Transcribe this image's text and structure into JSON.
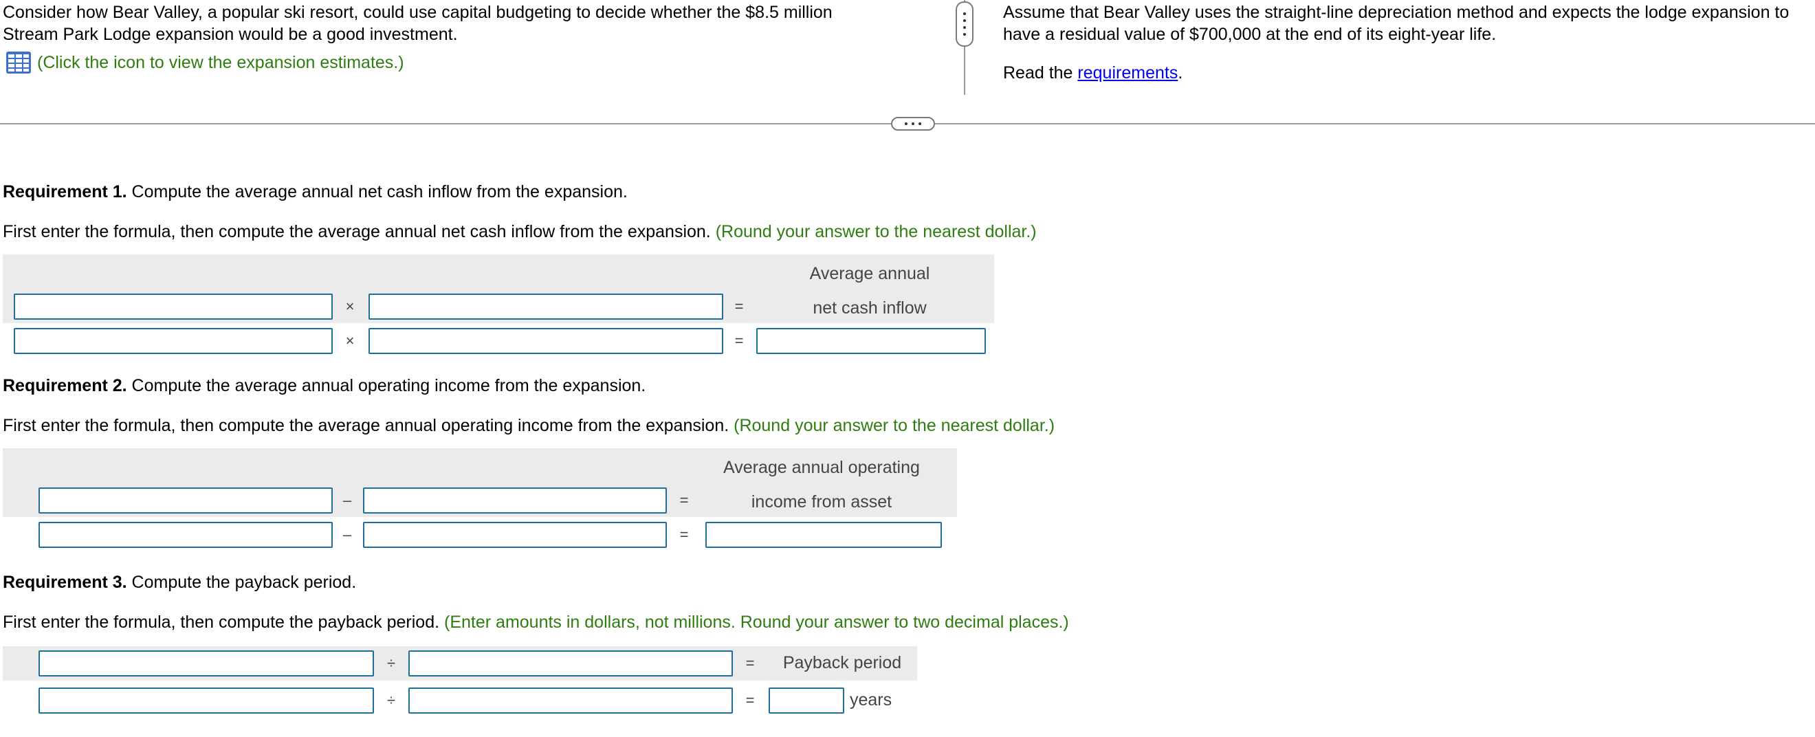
{
  "intro": {
    "line1": "Consider how Bear Valley, a popular ski resort, could use capital budgeting to decide whether the $8.5 million",
    "line2": "Stream Park Lodge expansion would be a good investment.",
    "estimates_link": "(Click the icon to view the expansion estimates.)"
  },
  "right": {
    "line1": "Assume that Bear Valley uses the straight-line depreciation method and expects the lodge expansion to",
    "line2": "have a residual value of $700,000 at the end of its eight-year life.",
    "read_prefix": "Read the ",
    "requirements_link": "requirements",
    "read_suffix": "."
  },
  "req1": {
    "head": "Requirement 1.",
    "title": " Compute the average annual net cash inflow from the expansion.",
    "instruction": "First enter the formula, then compute the average annual net cash inflow from the expansion. ",
    "hint": "(Round your answer to the nearest dollar.)",
    "op": "×",
    "eq": "=",
    "result_label_1": "Average annual",
    "result_label_2": "net cash inflow"
  },
  "req2": {
    "head": "Requirement 2.",
    "title": " Compute the average annual operating income from the expansion.",
    "instruction": "First enter the formula, then compute the average annual operating income from the expansion. ",
    "hint": "(Round your answer to the nearest dollar.)",
    "op": "–",
    "eq": "=",
    "result_label_1": "Average annual operating",
    "result_label_2": "income from asset"
  },
  "req3": {
    "head": "Requirement 3.",
    "title": " Compute the payback period.",
    "instruction": "First enter the formula, then compute the payback period. ",
    "hint": "(Enter amounts in dollars, not millions. Round your answer to two decimal places.)",
    "op": "÷",
    "eq": "=",
    "result_label": "Payback period",
    "unit": "years"
  },
  "icons": {
    "table_icon": "table-grid-icon",
    "vertical_handle": "vertical-ellipsis-icon",
    "horizontal_handle": "horizontal-ellipsis-icon"
  },
  "colors": {
    "hint_green": "#2e7d0f",
    "input_border": "#1f6ea0",
    "shade": "#ebebeb",
    "link_blue": "#0000ee"
  }
}
